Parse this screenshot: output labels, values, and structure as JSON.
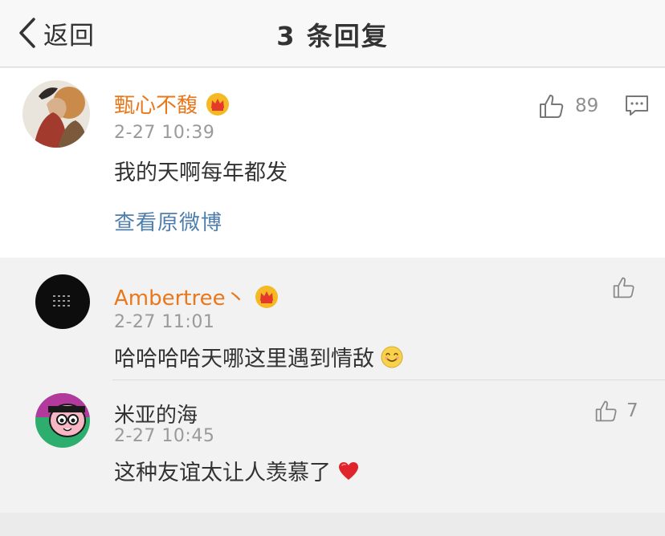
{
  "nav": {
    "back_label": "返回",
    "title": "3 条回复"
  },
  "main": {
    "username": "甄心不馥",
    "time": "2-27 10:39",
    "text": "我的天啊每年都发",
    "like_count": "89",
    "view_original": "查看原微博"
  },
  "replies": [
    {
      "username": "Ambertree丶",
      "time": "2-27 11:01",
      "text": "哈哈哈哈天哪这里遇到情敌",
      "like_count": "",
      "emoji": "smiling-face"
    },
    {
      "username": "米亚的海",
      "time": "2-27 10:45",
      "text": "这种友谊太让人羡慕了",
      "like_count": "7",
      "emoji": "red-heart"
    }
  ],
  "colors": {
    "vip_name": "#e8781b",
    "link": "#4f7fad",
    "meta": "#9a9a9a"
  }
}
